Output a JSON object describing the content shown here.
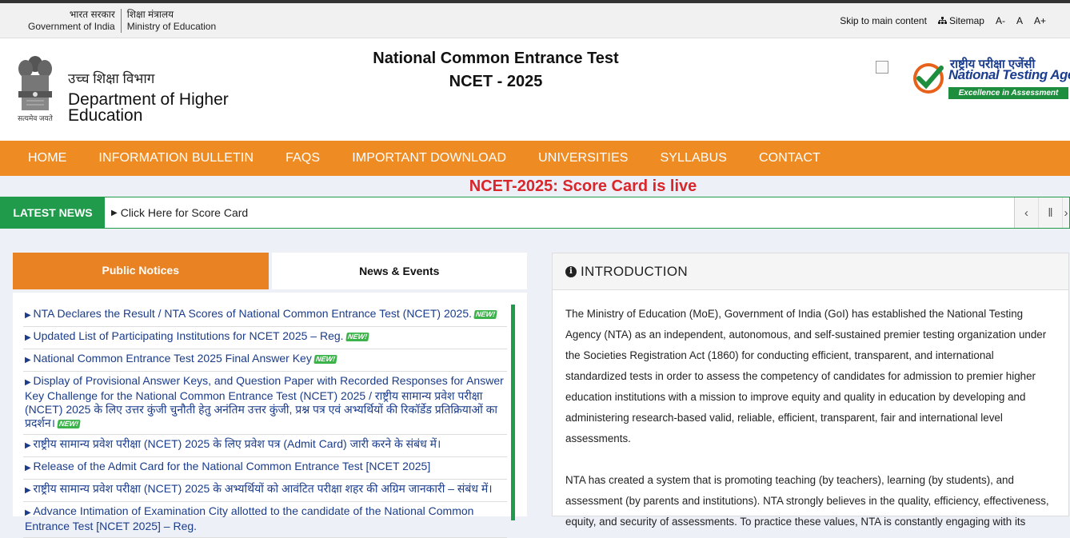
{
  "gov_bar": {
    "gov_hi": "भारत सरकार",
    "gov_en": "Government of India",
    "ministry_hi": "शिक्षा मंत्रालय",
    "ministry_en": "Ministry of Education",
    "skip": "Skip to main content",
    "sitemap": "Sitemap",
    "font_small": "A-",
    "font_normal": "A",
    "font_large": "A+"
  },
  "header": {
    "motto": "सत्यमेव जयते",
    "dept_hi": "उच्च शिक्षा विभाग",
    "dept_en": "Department of Higher Education",
    "title_line1": "National Common Entrance Test",
    "title_line2": "NCET - 2025",
    "nta_hi": "राष्ट्रीय परीक्षा एजेंसी",
    "nta_en": "National Testing Agency",
    "nta_tagline": "Excellence in Assessment"
  },
  "nav": {
    "items": [
      "HOME",
      "INFORMATION BULLETIN",
      "FAQS",
      "IMPORTANT DOWNLOAD",
      "UNIVERSITIES",
      "SYLLABUS",
      "CONTACT"
    ]
  },
  "announcement": "NCET-2025: Score Card is live",
  "latest_news": {
    "label": "LATEST NEWS",
    "text": "Click Here for Score Card"
  },
  "tabs": {
    "public_notices": "Public Notices",
    "news_events": "News & Events"
  },
  "notices": [
    {
      "text": "NTA Declares the Result / NTA Scores of National Common Entrance Test (NCET) 2025.",
      "new": true
    },
    {
      "text": "Updated List of Participating Institutions for NCET 2025 – Reg.",
      "new": true
    },
    {
      "text": "National Common Entrance Test 2025 Final Answer Key",
      "new": true
    },
    {
      "text": "Display of Provisional Answer Keys, and Question Paper with Recorded Responses for Answer Key Challenge for the National Common Entrance Test (NCET) 2025 / राष्ट्रीय सामान्य प्रवेश परीक्षा (NCET) 2025 के लिए उत्तर कुंजी चुनौती हेतु अनंतिम उत्तर कुंजी, प्रश्न पत्र एवं अभ्यर्थियों की रिकॉर्डेड प्रतिक्रियाओं का प्रदर्शन।",
      "new": true
    },
    {
      "text": "राष्ट्रीय सामान्य प्रवेश परीक्षा (NCET) 2025 के लिए प्रवेश पत्र (Admit Card) जारी करने के संबंध में।",
      "new": false
    },
    {
      "text": "Release of the Admit Card for the National Common Entrance Test [NCET 2025]",
      "new": false
    },
    {
      "text": "राष्ट्रीय सामान्य प्रवेश परीक्षा (NCET) 2025 के अभ्यर्थियों को आवंटित परीक्षा शहर की अग्रिम जानकारी – संबंध में।",
      "new": false
    },
    {
      "text": "Advance Intimation of Examination City allotted to the candidate of the National Common Entrance Test [NCET 2025] – Reg.",
      "new": false
    }
  ],
  "new_badge": "NEW!",
  "intro": {
    "heading": "INTRODUCTION",
    "para1": "The Ministry of Education (MoE), Government of India (GoI) has established the National Testing Agency (NTA) as an independent, autonomous, and self-sustained premier testing organization under the Societies Registration Act (1860) for conducting efficient, transparent, and international standardized tests in order to assess the competency of candidates for admission to premier higher education institutions with a mission to improve equity and quality in education by developing and administering research-based valid, reliable, efficient, transparent, fair and international level assessments.",
    "para2": "NTA has created a system that is promoting teaching (by teachers), learning (by students), and assessment (by parents and institutions). NTA strongly believes in the quality, efficiency, effectiveness, equity, and security of assessments. To practice these values, NTA is constantly engaging with its"
  },
  "colors": {
    "nav_orange": "#ef8b23",
    "news_green": "#1f9b4b",
    "announce_red": "#d9262b",
    "link_blue": "#1a3c8a"
  }
}
